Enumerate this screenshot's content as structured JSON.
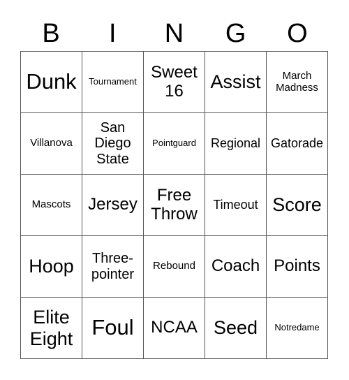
{
  "header": {
    "letters": [
      "B",
      "I",
      "N",
      "G",
      "O"
    ]
  },
  "cells": [
    [
      "Dunk",
      "Tournament",
      "Sweet 16",
      "Assist",
      "March Madness"
    ],
    [
      "Villanova",
      "San Diego State",
      "Pointguard",
      "Regional",
      "Gatorade"
    ],
    [
      "Mascots",
      "Jersey",
      "Free Throw",
      "Timeout",
      "Score"
    ],
    [
      "Hoop",
      "Three-pointer",
      "Rebound",
      "Coach",
      "Points"
    ],
    [
      "Elite Eight",
      "Foul",
      "NCAA",
      "Seed",
      "Notredame"
    ]
  ]
}
